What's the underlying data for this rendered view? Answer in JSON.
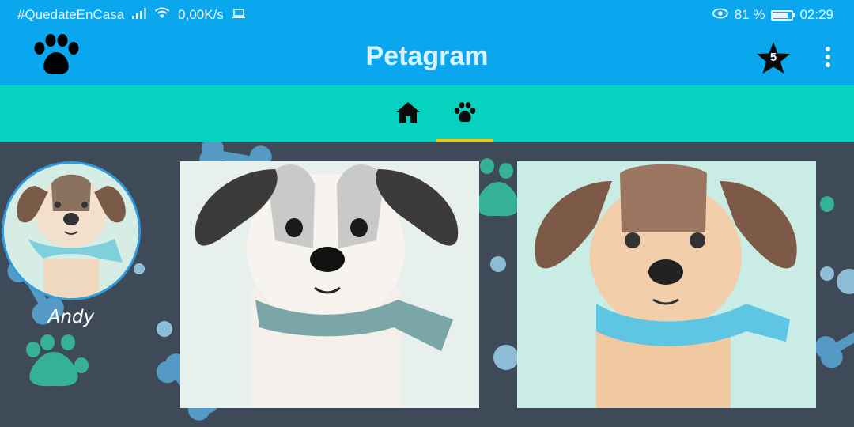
{
  "status_bar": {
    "carrier_text": "#QuedateEnCasa",
    "network_speed": "0,00K/s",
    "battery_percent": "81 %",
    "battery_level": 0.81,
    "time": "02:29",
    "icons": [
      "signal-icon",
      "wifi-icon",
      "laptop-icon",
      "eye-icon",
      "battery-icon"
    ]
  },
  "app_bar": {
    "title": "Petagram",
    "logo_icon": "paw-icon",
    "favorites_count": "5",
    "favorites_icon": "star-icon",
    "menu_icon": "more-vert-icon"
  },
  "tabs": {
    "items": [
      {
        "icon": "home-icon",
        "selected": false
      },
      {
        "icon": "paw-icon",
        "selected": true
      }
    ],
    "indicator_color": "#e8c91b"
  },
  "profile": {
    "pet_name": "Andy"
  },
  "colors": {
    "app_bar": "#0aa7ee",
    "tab_bar": "#07d1bf",
    "background": "#3e4a57",
    "avatar_border": "#2f9be0"
  }
}
